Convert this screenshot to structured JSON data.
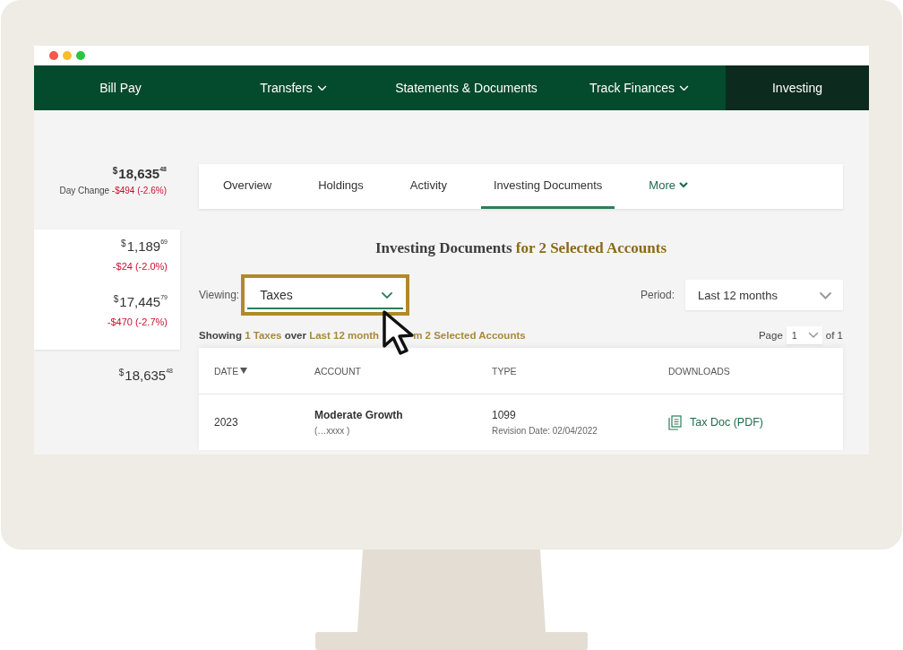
{
  "nav": [
    {
      "label": "Bill Pay",
      "dropdown": false,
      "selected": false
    },
    {
      "label": "Transfers",
      "dropdown": true,
      "selected": false
    },
    {
      "label": "Statements & Documents",
      "dropdown": false,
      "selected": false
    },
    {
      "label": "Track Finances",
      "dropdown": true,
      "selected": false
    },
    {
      "label": "Investing",
      "dropdown": false,
      "selected": true
    }
  ],
  "sidebar": {
    "summary": {
      "currency": "$",
      "amount": "18,635",
      "cents": "48",
      "label": "Day Change",
      "change": "-$494 (-2.6%)"
    },
    "accounts": [
      {
        "currency": "$",
        "amount": "1,189",
        "cents": "69",
        "change": "-$24 (-2.0%)"
      },
      {
        "currency": "$",
        "amount": "17,445",
        "cents": "79",
        "change": "-$470 (-2.7%)"
      }
    ],
    "total": {
      "currency": "$",
      "amount": "18,635",
      "cents": "48"
    }
  },
  "tabs": [
    {
      "label": "Overview",
      "selected": false,
      "dropdown": false
    },
    {
      "label": "Holdings",
      "selected": false,
      "dropdown": false
    },
    {
      "label": "Activity",
      "selected": false,
      "dropdown": false
    },
    {
      "label": "Investing Documents",
      "selected": true,
      "dropdown": false
    },
    {
      "label": "More",
      "selected": false,
      "dropdown": true
    }
  ],
  "heading": {
    "text": "Investing Documents",
    "accent": "for 2 Selected Accounts"
  },
  "viewing": {
    "label": "Viewing:",
    "value": "Taxes",
    "highlighted": true
  },
  "period": {
    "label": "Period:",
    "value": "Last 12 months"
  },
  "showing": [
    {
      "text": "Showing",
      "accent": false
    },
    {
      "text": "1 Taxes",
      "accent": true
    },
    {
      "text": "over",
      "accent": false
    },
    {
      "text": "Last 12 month",
      "accent": true
    },
    {
      "text": "m 2 Selected Accounts",
      "accent": true
    }
  ],
  "pager": {
    "label": "Page",
    "value": "1",
    "total": "of 1"
  },
  "table": {
    "columns": [
      {
        "label": "DATE",
        "sorted": true
      },
      {
        "label": "ACCOUNT",
        "sorted": false
      },
      {
        "label": "TYPE",
        "sorted": false
      },
      {
        "label": "DOWNLOADS",
        "sorted": false
      }
    ],
    "rows": [
      {
        "date": "2023",
        "account": "Moderate Growth",
        "account_number": "(…xxxx )",
        "type": "1099",
        "revision": "Revision Date: 02/04/2022",
        "download": "Tax Doc (PDF)"
      }
    ]
  }
}
